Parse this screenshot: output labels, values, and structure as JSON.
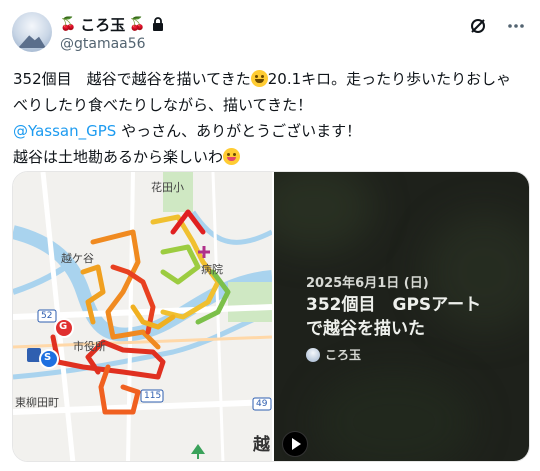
{
  "user": {
    "display_name_prefix": "🍒",
    "display_name": "ころ玉",
    "display_name_suffix": "🍒",
    "handle": "@gtamaa56"
  },
  "tweet": {
    "line1_a": "352個目　越谷で越谷を描いてきた",
    "line1_b": "20.1キロ。走ったり歩いたりおしゃ",
    "line2": "べりしたり食べたりしながら、描いてきた！",
    "mention": "@Yassan_GPS",
    "line3_rest": " やっさん、ありがとうございます！",
    "line4": "越谷は土地勘あるから楽しいわ"
  },
  "map": {
    "labels": {
      "hanada": "花田小",
      "koshigaya_station_short": "越ケ谷",
      "hospital": "病院",
      "city_hall": "市役所",
      "higashi_yanagi": "東柳田町",
      "route_52": "52",
      "route_115": "115",
      "route_49": "49",
      "big_kanji": "越"
    },
    "markers": {
      "goal": "G",
      "start": "S"
    },
    "route_colors": [
      "#e02020",
      "#f07020",
      "#f0b020",
      "#a8d040",
      "#60c060"
    ]
  },
  "video": {
    "date": "2025年6月1日 (日)",
    "title": "352個目　GPSアート\nで越谷を描いた",
    "author": "ころ玉"
  }
}
